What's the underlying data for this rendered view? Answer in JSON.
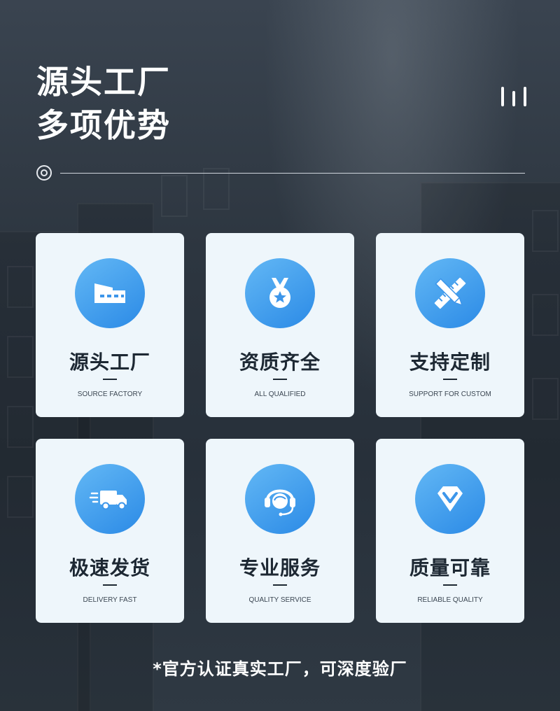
{
  "header": {
    "title_line1": "源头工厂",
    "title_line2": "多项优势"
  },
  "cards": [
    {
      "title": "源头工厂",
      "subtitle": "SOURCE FACTORY",
      "icon": "factory-icon"
    },
    {
      "title": "资质齐全",
      "subtitle": "ALL QUALIFIED",
      "icon": "medal-icon"
    },
    {
      "title": "支持定制",
      "subtitle": "SUPPORT FOR CUSTOM",
      "icon": "ruler-pencil-icon"
    },
    {
      "title": "极速发货",
      "subtitle": "DELIVERY FAST",
      "icon": "delivery-truck-icon"
    },
    {
      "title": "专业服务",
      "subtitle": "QUALITY SERVICE",
      "icon": "customer-service-icon"
    },
    {
      "title": "质量可靠",
      "subtitle": "RELIABLE QUALITY",
      "icon": "diamond-icon"
    }
  ],
  "footer": {
    "note": "*官方认证真实工厂，可深度验厂"
  },
  "colors": {
    "accent_blue": "#2b8ae6",
    "card_bg": "#eef6fb",
    "text_dark": "#1d2833"
  }
}
